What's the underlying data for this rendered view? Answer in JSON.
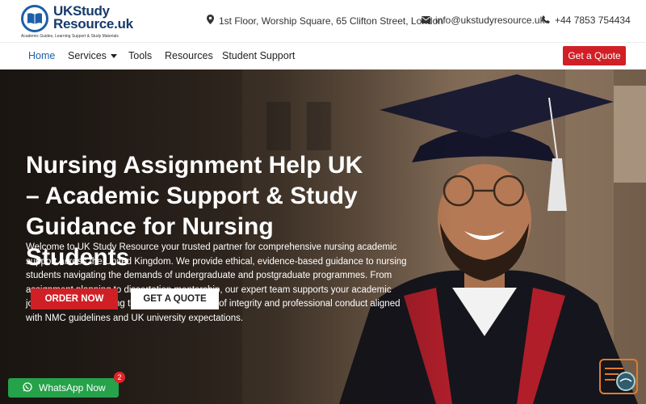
{
  "header": {
    "logo_line1": "UKStudy",
    "logo_line2": "Resource.uk",
    "logo_tagline": "Academic Guides, Learning Support & Study Materials",
    "address": "1st Floor, Worship Square, 65 Clifton Street, London",
    "email": "info@ukstudyresource.uk",
    "phone": "+44 7853 754434"
  },
  "nav": {
    "items": [
      {
        "label": "Home"
      },
      {
        "label": "Services"
      },
      {
        "label": "Tools"
      },
      {
        "label": "Resources"
      },
      {
        "label": "Student Support"
      }
    ],
    "cta_label": "Get a Quote"
  },
  "hero": {
    "title": "Nursing Assignment Help UK – Academic Support & Study Guidance for Nursing Students",
    "description": "Welcome to UK Study Resource your trusted partner for comprehensive nursing academic support across the United Kingdom. We provide ethical, evidence-based guidance to nursing students navigating the demands of undergraduate and postgraduate programmes. From assignment planning to dissertation mentorship, our expert team supports your academic journey whilst upholding the highest standards of integrity and professional conduct aligned with NMC guidelines and UK university expectations.",
    "order_label": "ORDER NOW",
    "quote_label": "GET A QUOTE"
  },
  "whatsapp": {
    "label": "WhatsApp Now",
    "badge": "2"
  },
  "colors": {
    "brand_blue": "#1d5ea8",
    "accent_red": "#d11f26",
    "whatsapp_green": "#25a24a"
  },
  "icons": {
    "address": "map-pin-icon",
    "email": "envelope-icon",
    "phone": "phone-icon",
    "whatsapp": "whatsapp-icon",
    "corner": "chat-widget-icon"
  }
}
